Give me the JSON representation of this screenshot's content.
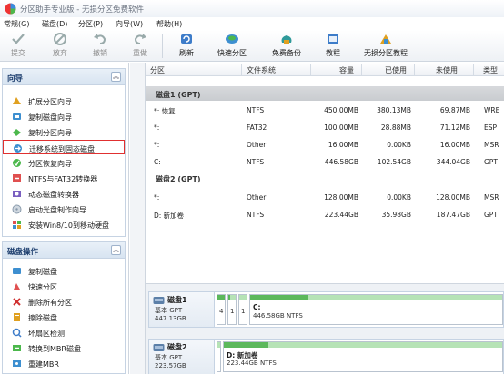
{
  "window": {
    "title": "分区助手专业版 - 无损分区免费软件"
  },
  "menu": [
    "常规(G)",
    "磁盘(D)",
    "分区(P)",
    "向导(W)",
    "帮助(H)"
  ],
  "toolbar": {
    "commit": "提交",
    "discard": "放弃",
    "undo": "撤销",
    "redo": "重做",
    "refresh": "刷新",
    "quick_partition": "快速分区",
    "free_backup": "免费备份",
    "tutorial": "教程",
    "lossless_tutorial": "无损分区教程"
  },
  "wizard_panel": {
    "title": "向导",
    "items": [
      "扩展分区向导",
      "复制磁盘向导",
      "复制分区向导",
      "迁移系统到固态磁盘",
      "分区恢复向导",
      "NTFS与FAT32转换器",
      "动态磁盘转换器",
      "启动光盘制作向导",
      "安装Win8/10到移动硬盘"
    ]
  },
  "disk_ops_panel": {
    "title": "磁盘操作",
    "items": [
      "复制磁盘",
      "快速分区",
      "删除所有分区",
      "擦除磁盘",
      "坏扇区检测",
      "转换到MBR磁盘",
      "重建MBR"
    ]
  },
  "table": {
    "columns": [
      "分区",
      "文件系统",
      "容量",
      "已使用",
      "未使用",
      "类型"
    ],
    "disk1_label": "磁盘1 (GPT)",
    "disk2_label": "磁盘2 (GPT)",
    "disk1_rows": [
      [
        "*: 恢复",
        "NTFS",
        "450.00MB",
        "380.13MB",
        "69.87MB",
        "WRE"
      ],
      [
        "*:",
        "FAT32",
        "100.00MB",
        "28.88MB",
        "71.12MB",
        "ESP"
      ],
      [
        "*:",
        "Other",
        "16.00MB",
        "0.00KB",
        "16.00MB",
        "MSR"
      ],
      [
        "C:",
        "NTFS",
        "446.58GB",
        "102.54GB",
        "344.04GB",
        "GPT"
      ]
    ],
    "disk2_rows": [
      [
        "*:",
        "Other",
        "128.00MB",
        "0.00KB",
        "128.00MB",
        "MSR"
      ],
      [
        "D: 新加卷",
        "NTFS",
        "223.44GB",
        "35.98GB",
        "187.47GB",
        "GPT"
      ]
    ]
  },
  "disk_map": {
    "disk1": {
      "name": "磁盘1",
      "type": "基本 GPT",
      "size": "447.13GB",
      "small_nums": [
        "4",
        "1",
        "1"
      ],
      "main_part_label": "C:",
      "main_part_info": "446.58GB NTFS",
      "main_used_fraction": 0.23
    },
    "disk2": {
      "name": "磁盘2",
      "type": "基本 GPT",
      "size": "223.57GB",
      "main_part_label": "D: 新加卷",
      "main_part_info": "223.44GB NTFS",
      "main_used_fraction": 0.16
    }
  }
}
